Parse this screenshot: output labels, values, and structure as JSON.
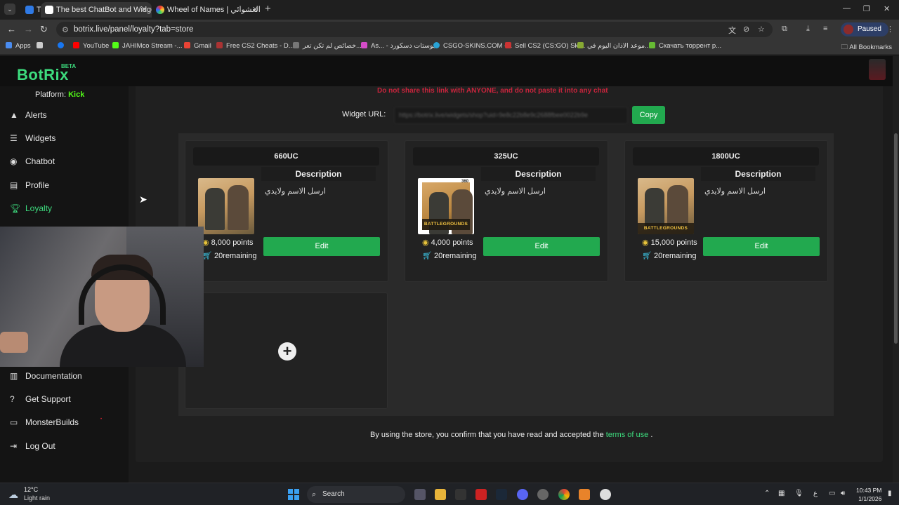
{
  "browser": {
    "tabs": [
      {
        "title": "The best ChatBot and Widgets"
      },
      {
        "title": "Wheel of Names | اسم العشوائي"
      }
    ],
    "url": "botrix.live/panel/loyalty?tab=store",
    "profile_status": "Paused",
    "bookmarks": [
      {
        "label": "Apps"
      },
      {
        "label": "YouTube"
      },
      {
        "label": "JAHIMco Stream -..."
      },
      {
        "label": "Gmail"
      },
      {
        "label": "Free CS2 Cheats - D..."
      },
      {
        "label": "خصائص لم تكن تعر..."
      },
      {
        "label": "As... - بوستات دسكورد"
      },
      {
        "label": "CSGO-SKINS.COM -..."
      },
      {
        "label": "Sell CS2 (CS:GO) Ski..."
      },
      {
        "label": "موعد الاذان اليوم في..."
      },
      {
        "label": "Скачать торрент р..."
      }
    ],
    "all_bookmarks": "All Bookmarks"
  },
  "app": {
    "logo": "BotRix",
    "logo_badge": "BETA"
  },
  "sidebar": {
    "platform_label": "Platform:",
    "platform_value": "Kick",
    "items": [
      {
        "label": "Alerts",
        "icon": "warning-icon"
      },
      {
        "label": "Widgets",
        "icon": "list-icon"
      },
      {
        "label": "Chatbot",
        "icon": "robot-icon"
      },
      {
        "label": "Profile",
        "icon": "id-card-icon"
      },
      {
        "label": "Loyalty",
        "icon": "trophy-icon",
        "active": true
      },
      {
        "label": "Documentation",
        "icon": "book-icon"
      },
      {
        "label": "Get Support",
        "icon": "question-icon"
      },
      {
        "label": "MonsterBuilds",
        "icon": "laptop-icon"
      },
      {
        "label": "Log Out",
        "icon": "logout-icon"
      }
    ]
  },
  "store": {
    "warning": "Do not share this link with ANYONE, and do not paste it into any chat",
    "widget_label": "Widget URL:",
    "widget_url": "https://botrix.live/widgets/shop?uid=9e8c22b8e9c2688fbee0022b9e",
    "copy_label": "Copy",
    "items": [
      {
        "title": "660UC",
        "desc_title": "Description",
        "desc": "ارسل الاسم ولايدي",
        "points": "8,000 points",
        "remaining": "20remaining",
        "edit": "Edit"
      },
      {
        "title": "325UC",
        "desc_title": "Description",
        "desc": "ارسل الاسم ولايدي",
        "points": "4,000 points",
        "remaining": "20remaining",
        "edit": "Edit"
      },
      {
        "title": "1800UC",
        "desc_title": "Description",
        "desc": "ارسل الاسم ولايدي",
        "points": "15,000 points",
        "remaining": "20remaining",
        "edit": "Edit"
      }
    ],
    "terms_prefix": "By using the store, you confirm that you have read and accepted the",
    "terms_link": "terms of use",
    "terms_suffix": "."
  },
  "taskbar": {
    "temperature": "12°C",
    "condition": "Light rain",
    "search": "Search",
    "time": "10:43 PM",
    "date": "1/1/2026"
  },
  "colors": {
    "accent_green": "#22a94f",
    "logo_green": "#3ddc7e",
    "kick_green": "#53fc18",
    "warning_red": "#c8243c"
  }
}
